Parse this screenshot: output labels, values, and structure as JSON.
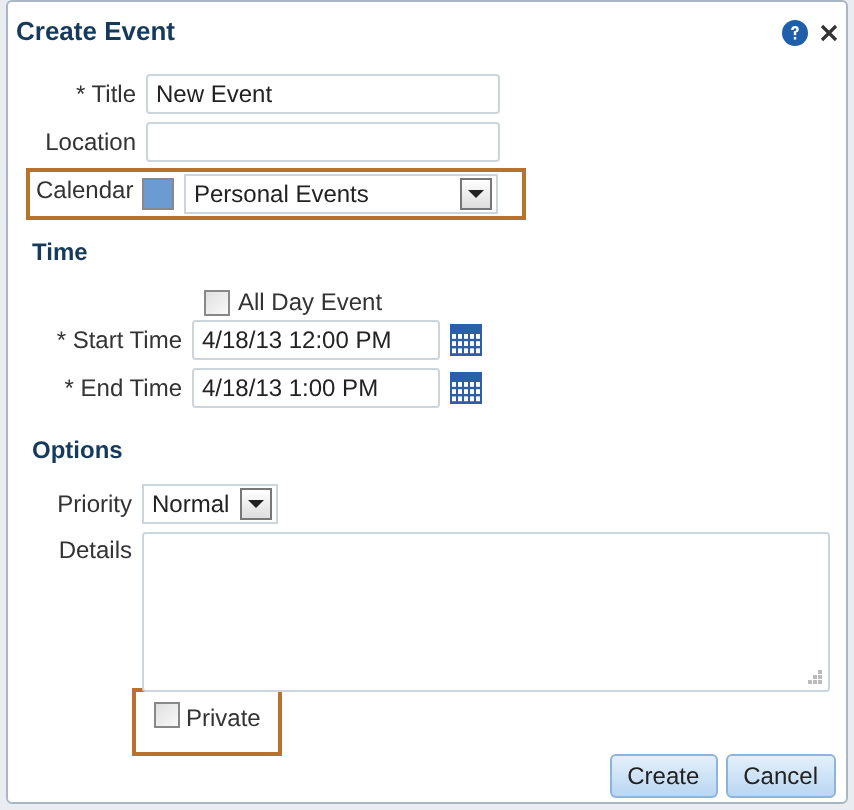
{
  "dialog": {
    "title": "Create Event"
  },
  "fields": {
    "title": {
      "label": "* Title",
      "value": "New Event"
    },
    "location": {
      "label": "Location"
    },
    "calendar": {
      "label": "Calendar",
      "value": "Personal Events",
      "color": "#6b9bd1",
      "highlighted": true
    }
  },
  "time": {
    "heading": "Time",
    "all_day": {
      "label": "All Day Event",
      "checked": false
    },
    "start": {
      "label": "* Start Time",
      "value": "4/18/13 12:00 PM"
    },
    "end": {
      "label": "* End Time",
      "value": "4/18/13 1:00 PM"
    }
  },
  "options": {
    "heading": "Options",
    "priority": {
      "label": "Priority",
      "value": "Normal"
    },
    "details": {
      "label": "Details"
    },
    "private": {
      "label": "Private",
      "checked": false,
      "highlighted": true
    }
  },
  "buttons": [
    {
      "label": "Create"
    },
    {
      "label": "Cancel"
    }
  ]
}
